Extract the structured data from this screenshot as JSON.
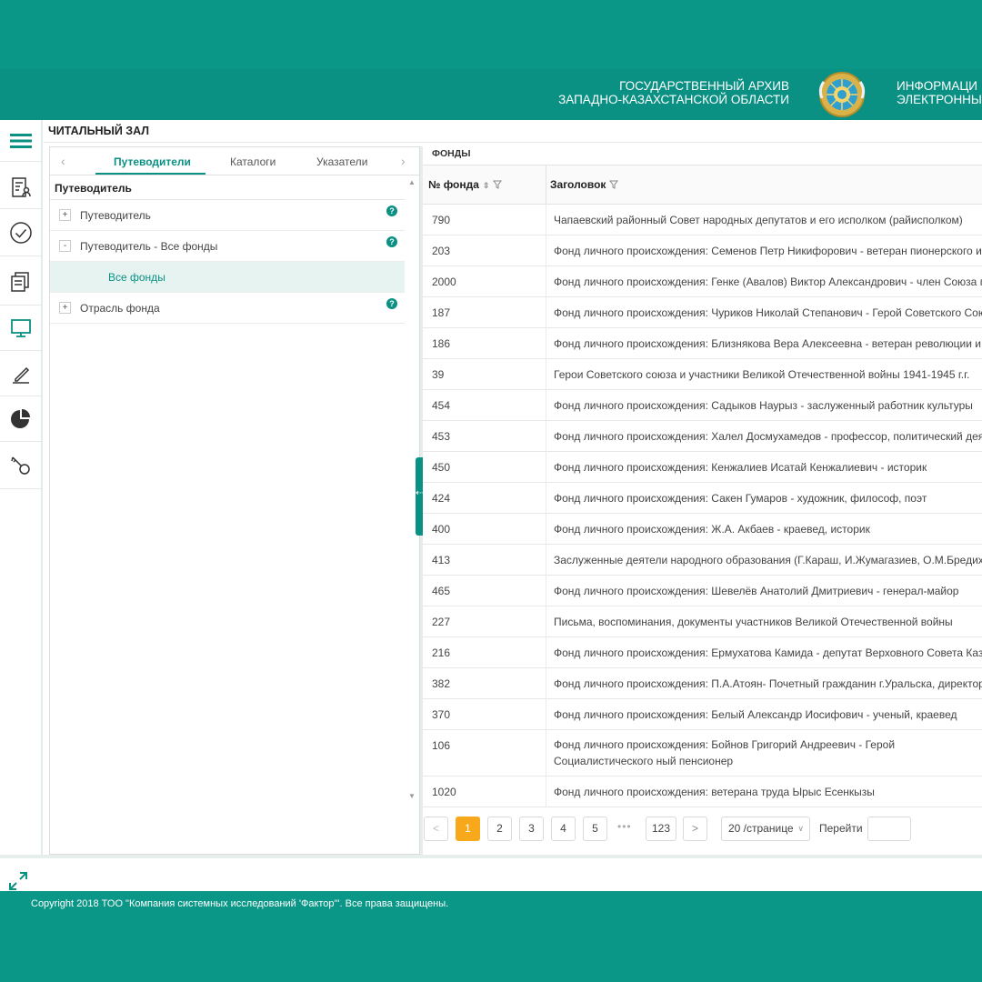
{
  "header": {
    "org_line1": "ГОСУДАРСТВЕННЫЙ АРХИВ",
    "org_line2": "ЗАПАДНО-КАЗАХСТАНСКОЙ ОБЛАСТИ",
    "system_line1": "ИНФОРМАЦИ",
    "system_line2": "ЭЛЕКТРОННЫ"
  },
  "page_title": "ЧИТАЛЬНЫЙ ЗАЛ",
  "sidebar": {
    "icons": [
      "menu-icon",
      "document-user-icon",
      "check-circle-icon",
      "copy-documents-icon",
      "monitor-icon",
      "pencil-icon",
      "pie-chart-icon",
      "key-icon"
    ]
  },
  "left_panel": {
    "tabs": [
      {
        "label": "Путеводители",
        "active": true
      },
      {
        "label": "Каталоги",
        "active": false
      },
      {
        "label": "Указатели",
        "active": false
      }
    ],
    "tree_header": "Путеводитель",
    "tree": [
      {
        "toggle": "+",
        "label": "Путеводитель",
        "help": "?"
      },
      {
        "toggle": "-",
        "label": "Путеводитель - Все фонды",
        "help": "?"
      },
      {
        "toggle": "",
        "label": "Все фонды",
        "help": ""
      },
      {
        "toggle": "+",
        "label": "Отрасль фонда",
        "help": "?"
      }
    ]
  },
  "funds_table": {
    "section_label": "ФОНДЫ",
    "columns": {
      "number": "№ фонда",
      "title": "Заголовок"
    },
    "rows": [
      {
        "number": "790",
        "title": "Чапаевский районный Совет народных депутатов и его исполком (райисполком)"
      },
      {
        "number": "203",
        "title": "Фонд личного происхождения: Семенов Петр Никифорович - ветеран пионерского и ко"
      },
      {
        "number": "2000",
        "title": "Фонд личного происхождения: Генке (Авалов) Виктор Александрович - член Союза пис"
      },
      {
        "number": "187",
        "title": "Фонд личного происхождения: Чуриков Николай Степанович - Герой Советского Союза"
      },
      {
        "number": "186",
        "title": "Фонд личного происхождения: Близнякова Вера Алексеевна - ветеран революции и гр"
      },
      {
        "number": "39",
        "title": "Герои Советского союза и участники Великой Отечественной войны 1941-1945 г.г."
      },
      {
        "number": "454",
        "title": "Фонд личного происхождения: Садыков Наурыз - заслуженный работник культуры"
      },
      {
        "number": "453",
        "title": "Фонд личного происхождения: Халел Досмухамедов - профессор, политический деяте"
      },
      {
        "number": "450",
        "title": "Фонд личного происхождения: Кенжалиев Исатай Кенжалиевич - историк"
      },
      {
        "number": "424",
        "title": "Фонд личного происхождения: Сакен Гумаров - художник, философ, поэт"
      },
      {
        "number": "400",
        "title": "Фонд личного происхождения: Ж.А. Акбаев - краевед, историк"
      },
      {
        "number": "413",
        "title": "Заслуженные деятели народного образования (Г.Караш, И.Жумагазиев, О.М.Бредихин"
      },
      {
        "number": "465",
        "title": "Фонд личного происхождения: Шевелёв Анатолий Дмитриевич - генерал-майор"
      },
      {
        "number": "227",
        "title": "Письма, воспоминания, документы участников Великой Отечественной войны"
      },
      {
        "number": "216",
        "title": "Фонд личного происхождения: Ермухатова Камида - депутат Верховного Совета Казах"
      },
      {
        "number": "382",
        "title": "Фонд личного происхождения: П.А.Атоян- Почетный гражданин г.Уральска, директор за"
      },
      {
        "number": "370",
        "title": "Фонд личного происхождения: Белый Александр Иосифович - ученый, краевед"
      },
      {
        "number": "106",
        "title": "Фонд личного происхождения: Бойнов Григорий Андреевич - Герой Социалистического ный пенсионер"
      },
      {
        "number": "1020",
        "title": "Фонд личного происхождения: ветерана труда Ырыс Есенкызы"
      }
    ]
  },
  "pagination": {
    "prev": "<",
    "pages": [
      "1",
      "2",
      "3",
      "4",
      "5"
    ],
    "current": "1",
    "dots": "•••",
    "last": "123",
    "next": ">",
    "page_size": "20 /странице",
    "goto_label": "Перейти"
  },
  "footer": {
    "copyright": "Copyright 2018 ТОО \"Компания системных исследований 'Фактор'\". Все права защищены."
  },
  "colors": {
    "brand": "#0a9183",
    "accent": "#f7a81b"
  }
}
